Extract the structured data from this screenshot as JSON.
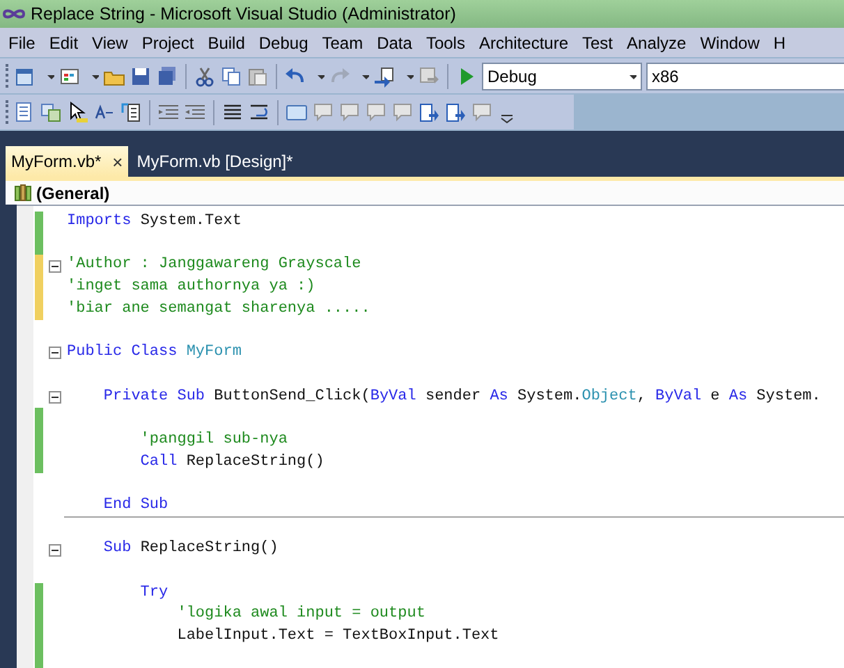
{
  "window": {
    "title": "Replace String - Microsoft Visual Studio (Administrator)"
  },
  "menu": [
    "File",
    "Edit",
    "View",
    "Project",
    "Build",
    "Debug",
    "Team",
    "Data",
    "Tools",
    "Architecture",
    "Test",
    "Analyze",
    "Window",
    "H"
  ],
  "toolbar": {
    "configuration": "Debug",
    "platform": "x86"
  },
  "tabs": [
    {
      "label": "MyForm.vb*",
      "selected": true,
      "close": "×"
    },
    {
      "label": "MyForm.vb [Design]*",
      "selected": false
    }
  ],
  "member_dropdown": "(General)",
  "code": [
    {
      "modified": true,
      "saved": true,
      "tokens": [
        {
          "kind": "keyword",
          "text": "Imports"
        },
        {
          "kind": "plain",
          "text": " System.Text"
        }
      ]
    },
    {
      "modified": true,
      "saved": true
    },
    {
      "modified": true,
      "saved": false,
      "fold": true,
      "tokens": [
        {
          "kind": "comment",
          "text": "'Author : Janggawareng Grayscale"
        }
      ]
    },
    {
      "modified": true,
      "saved": false,
      "tokens": [
        {
          "kind": "comment",
          "text": "'inget sama authornya ya :)"
        }
      ]
    },
    {
      "modified": true,
      "saved": false,
      "tokens": [
        {
          "kind": "comment",
          "text": "'biar ane semangat sharenya ....."
        }
      ]
    },
    {
      "modified": false
    },
    {
      "modified": false,
      "fold": true,
      "tokens": [
        {
          "kind": "keyword",
          "text": "Public"
        },
        {
          "kind": "keyword",
          "text": " Class"
        },
        {
          "kind": "type",
          "text": " MyForm"
        }
      ]
    },
    {
      "modified": false
    },
    {
      "modified": false,
      "fold": true,
      "tokens": [
        {
          "kind": "keyword",
          "text": "    Private"
        },
        {
          "kind": "keyword",
          "text": " Sub"
        },
        {
          "kind": "plain",
          "text": " ButtonSend_Click("
        },
        {
          "kind": "keyword",
          "text": "ByVal"
        },
        {
          "kind": "plain",
          "text": " sender"
        },
        {
          "kind": "keyword",
          "text": " As"
        },
        {
          "kind": "plain",
          "text": " System."
        },
        {
          "kind": "type",
          "text": "Object"
        },
        {
          "kind": "plain",
          "text": ","
        },
        {
          "kind": "keyword",
          "text": " ByVal"
        },
        {
          "kind": "plain",
          "text": " e"
        },
        {
          "kind": "keyword",
          "text": " As"
        },
        {
          "kind": "plain",
          "text": " System."
        }
      ]
    },
    {
      "modified": true,
      "saved": true
    },
    {
      "modified": true,
      "saved": true,
      "tokens": [
        {
          "kind": "comment",
          "text": "        'panggil sub-nya"
        }
      ]
    },
    {
      "modified": true,
      "saved": true,
      "tokens": [
        {
          "kind": "keyword",
          "text": "        Call"
        },
        {
          "kind": "plain",
          "text": " ReplaceString()"
        }
      ]
    },
    {
      "modified": false
    },
    {
      "modified": false,
      "separator": true,
      "tokens": [
        {
          "kind": "keyword",
          "text": "    End"
        },
        {
          "kind": "keyword",
          "text": " Sub"
        }
      ]
    },
    {
      "modified": false
    },
    {
      "modified": false,
      "fold": true,
      "tokens": [
        {
          "kind": "keyword",
          "text": "    Sub"
        },
        {
          "kind": "plain",
          "text": " ReplaceString()"
        }
      ]
    },
    {
      "modified": false
    },
    {
      "modified": true,
      "saved": true,
      "tokens": [
        {
          "kind": "keyword",
          "text": "        Try"
        }
      ]
    },
    {
      "modified": true,
      "saved": true,
      "tokens": [
        {
          "kind": "comment",
          "text": "            'logika awal input = output"
        }
      ]
    },
    {
      "modified": true,
      "saved": true,
      "tokens": [
        {
          "kind": "plain",
          "text": "            LabelInput.Text = TextBoxInput.Text"
        }
      ]
    },
    {
      "modified": true,
      "saved": true
    }
  ]
}
